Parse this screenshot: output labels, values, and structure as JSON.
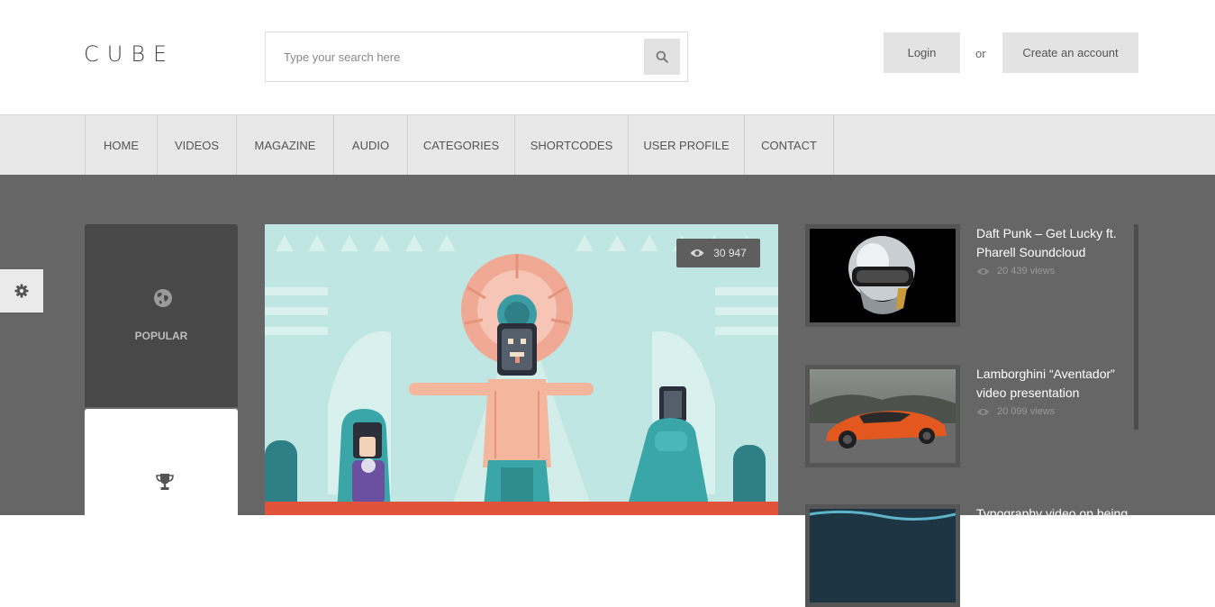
{
  "header": {
    "logo": "CUBE",
    "search_placeholder": "Type your search here",
    "login_label": "Login",
    "or_text": "or",
    "create_label": "Create an account"
  },
  "nav": {
    "items": [
      "HOME",
      "VIDEOS",
      "MAGAZINE",
      "AUDIO",
      "CATEGORIES",
      "SHORTCODES",
      "USER PROFILE",
      "CONTACT"
    ]
  },
  "tabs": {
    "popular_label": "POPULAR"
  },
  "feature": {
    "views": "30 947"
  },
  "sidebar": {
    "items": [
      {
        "title": "Daft Punk – Get Lucky ft. Pharell Soundcloud",
        "views": "20 439 views"
      },
      {
        "title": "Lamborghini “Aventador” video presentation",
        "views": "20 099 views"
      },
      {
        "title": "Typography video on being",
        "views": ""
      }
    ]
  },
  "icons": {
    "search": "search-icon",
    "gear": "gear-icon",
    "globe": "globe-icon",
    "trophy": "trophy-icon",
    "eye": "eye-icon"
  },
  "colors": {
    "main_bg": "#666666",
    "nav_bg": "#e8e8e8",
    "feature_accent": "#e0523a",
    "feature_bg": "#bfe6e2"
  }
}
